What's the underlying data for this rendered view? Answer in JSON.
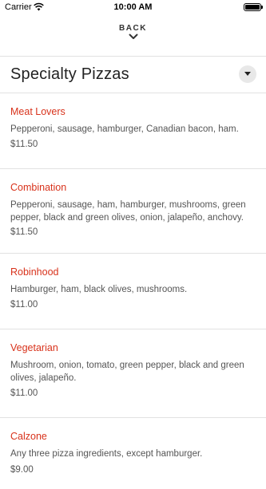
{
  "status_bar": {
    "carrier": "Carrier",
    "time": "10:00 AM"
  },
  "nav": {
    "back_label": "BACK"
  },
  "section": {
    "title": "Specialty Pizzas"
  },
  "items": [
    {
      "name": "Meat Lovers",
      "description": "Pepperoni, sausage, hamburger, Canadian bacon, ham.",
      "price": "$11.50"
    },
    {
      "name": "Combination",
      "description": "Pepperoni, sausage, ham, hamburger, mushrooms, green pepper, black and green olives, onion, jalapeño, anchovy.",
      "price": "$11.50"
    },
    {
      "name": "Robinhood",
      "description": "Hamburger, ham, black olives, mushrooms.",
      "price": "$11.00"
    },
    {
      "name": "Vegetarian",
      "description": "Mushroom, onion, tomato, green pepper, black and green olives, jalapeño.",
      "price": "$11.00"
    },
    {
      "name": "Calzone",
      "description": "Any three pizza ingredients, except hamburger.",
      "price": "$9.00"
    }
  ],
  "colors": {
    "accent": "#d8321b",
    "text": "#555555",
    "divider": "#e2e2e2"
  }
}
